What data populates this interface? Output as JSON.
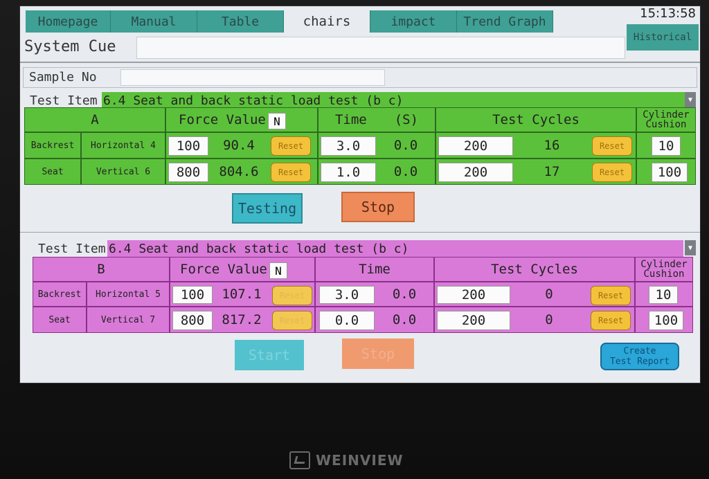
{
  "clock": "15:13:58",
  "tabs": [
    "Homepage",
    "Manual",
    "Table",
    "chairs",
    "impact",
    "Trend Graph"
  ],
  "historical_label": "Historical",
  "system_cue_label": "System Cue",
  "sample_no_label": "Sample No",
  "panelA": {
    "test_item_label": "Test Item",
    "test_item_value": "6.4 Seat and back static load test (b c)",
    "section": "A",
    "force_header": "Force Value",
    "force_unit": "N",
    "time_header": "Time",
    "time_unit": "(S)",
    "cycles_header": "Test Cycles",
    "cushion_header_line1": "Cylinder",
    "cushion_header_line2": "Cushion",
    "rows": [
      {
        "part": "Backrest",
        "direction": "Horizontal 4",
        "force_set": "100",
        "force_actual": "90.4",
        "reset1": "Reset",
        "time_set": "3.0",
        "time_actual": "0.0",
        "cycles_set": "200",
        "cycles_actual": "16",
        "reset2": "Reset",
        "cushion": "10"
      },
      {
        "part": "Seat",
        "direction": "Vertical 6",
        "force_set": "800",
        "force_actual": "804.6",
        "reset1": "Reset",
        "time_set": "1.0",
        "time_actual": "0.0",
        "cycles_set": "200",
        "cycles_actual": "17",
        "reset2": "Reset",
        "cushion": "100"
      }
    ],
    "btn_testing": "Testing",
    "btn_stop": "Stop"
  },
  "panelB": {
    "test_item_label": "Test Item",
    "test_item_value": "6.4 Seat and back static load test (b c)",
    "section": "B",
    "force_header": "Force Value",
    "force_unit": "N",
    "time_header": "Time",
    "cycles_header": "Test Cycles",
    "cushion_header_line1": "Cylinder",
    "cushion_header_line2": "Cushion",
    "rows": [
      {
        "part": "Backrest",
        "direction": "Horizontal 5",
        "force_set": "100",
        "force_actual": "107.1",
        "reset1": "Reset",
        "time_set": "3.0",
        "time_actual": "0.0",
        "cycles_set": "200",
        "cycles_actual": "0",
        "reset2": "Reset",
        "cushion": "10"
      },
      {
        "part": "Seat",
        "direction": "Vertical 7",
        "force_set": "800",
        "force_actual": "817.2",
        "reset1": "Reset",
        "time_set": "0.0",
        "time_actual": "0.0",
        "cycles_set": "200",
        "cycles_actual": "0",
        "reset2": "Reset",
        "cushion": "100"
      }
    ],
    "btn_start": "Start",
    "btn_stop": "Stop",
    "btn_report_line1": "Create",
    "btn_report_line2": "Test Report"
  },
  "brand": "WEINVIEW",
  "colors": {
    "green": "#5cc13a",
    "magenta": "#d97ad8",
    "teal": "#3fa095",
    "reset": "#f3c23a"
  }
}
